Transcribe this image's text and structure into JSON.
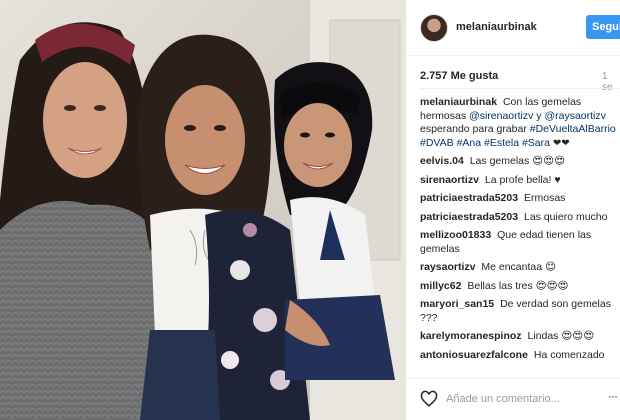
{
  "header": {
    "username": "melaniaurbinak",
    "follow_label": "Seguir"
  },
  "post": {
    "likes": "2.757 Me gusta",
    "time": "1 se",
    "caption": {
      "user": "melaniaurbinak",
      "text": "Con las gemelas hermosas",
      "mention1": "@sirenaortizv",
      "mid": "y",
      "mention2": "@raysaortizv",
      "text2": "esperando para grabar",
      "hashtags": "#DeVueltaAlBarrio #DVAB #Ana #Estela #Sara",
      "emoji": "❤❤"
    }
  },
  "comments": [
    {
      "user": "eelvis.04",
      "text": "Las gemelas",
      "emoji": "😍😍😍"
    },
    {
      "user": "sirenaortizv",
      "text": "La profe bella!",
      "emoji": "♥"
    },
    {
      "user": "patriciaestrada5203",
      "text": "Ermosas",
      "emoji": ""
    },
    {
      "user": "patriciaestrada5203",
      "text": "Las quiero mucho",
      "emoji": ""
    },
    {
      "user": "mellizoo01833",
      "text": "Que edad tienen las gemelas",
      "emoji": ""
    },
    {
      "user": "raysaortizv",
      "text": "Me encantaa",
      "emoji": "😊"
    },
    {
      "user": "millyc62",
      "text": "Bellas las tres",
      "emoji": "😍😍😍"
    },
    {
      "user": "maryori_san15",
      "text": "De verdad son gemelas ???",
      "emoji": ""
    },
    {
      "user": "karelymoranespinoz",
      "text": "Lindas",
      "emoji": "😍😍😍"
    },
    {
      "user": "antoniosuarezfalcone",
      "text": "Ha comenzado",
      "emoji": ""
    }
  ],
  "footer": {
    "comment_placeholder": "Añade un comentario...",
    "more_label": "···"
  },
  "icons": {
    "avatar": "avatar-icon",
    "like": "heart-icon",
    "more": "more-options-icon"
  },
  "colors": {
    "follow_button": "#3897f0",
    "hashtag": "#003569",
    "muted_text": "#999999"
  }
}
